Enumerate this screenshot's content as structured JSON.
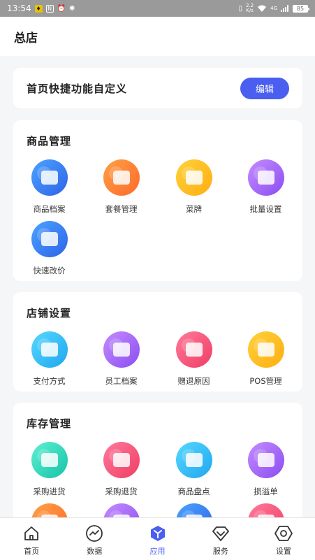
{
  "status_bar": {
    "time": "13:54",
    "net_speed_top": "2.2",
    "net_speed_bottom": "K/s",
    "signal_label": "4G",
    "battery": "85"
  },
  "header": {
    "title": "总店"
  },
  "shortcut": {
    "title": "首页快捷功能自定义",
    "edit_label": "编辑"
  },
  "sections": {
    "goods": {
      "title": "商品管理",
      "items": [
        {
          "label": "商品档案",
          "icon": "product-archive-icon",
          "color": "blue"
        },
        {
          "label": "套餐管理",
          "icon": "package-icon",
          "color": "orange"
        },
        {
          "label": "菜牌",
          "icon": "menu-board-icon",
          "color": "yellow"
        },
        {
          "label": "批量设置",
          "icon": "batch-settings-icon",
          "color": "purple"
        },
        {
          "label": "快速改价",
          "icon": "quick-price-icon",
          "color": "blue"
        }
      ]
    },
    "store": {
      "title": "店铺设置",
      "items": [
        {
          "label": "支付方式",
          "icon": "payment-icon",
          "color": "cyan"
        },
        {
          "label": "员工档案",
          "icon": "staff-icon",
          "color": "purple"
        },
        {
          "label": "赠退原因",
          "icon": "return-reason-icon",
          "color": "pink"
        },
        {
          "label": "POS管理",
          "icon": "pos-icon",
          "color": "yellow"
        }
      ]
    },
    "inventory": {
      "title": "库存管理",
      "items": [
        {
          "label": "采购进货",
          "icon": "purchase-in-icon",
          "color": "teal"
        },
        {
          "label": "采购退货",
          "icon": "purchase-return-icon",
          "color": "pink"
        },
        {
          "label": "商品盘点",
          "icon": "stocktake-icon",
          "color": "cyan"
        },
        {
          "label": "损溢单",
          "icon": "loss-gain-icon",
          "color": "purple"
        }
      ]
    }
  },
  "nav": {
    "home": "首页",
    "data": "数据",
    "apps": "应用",
    "service": "服务",
    "settings": "设置"
  }
}
